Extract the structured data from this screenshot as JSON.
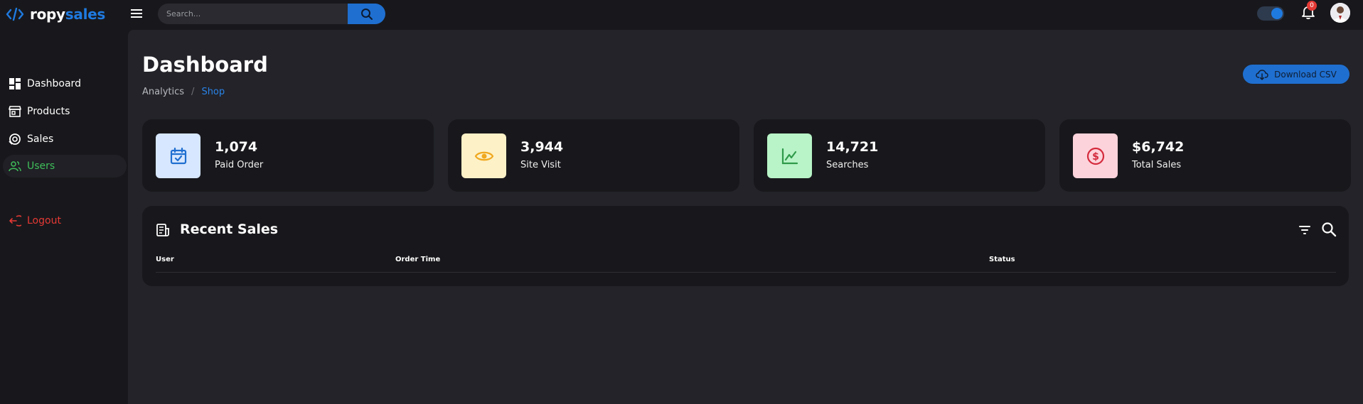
{
  "brand": {
    "part1": "ropy",
    "part2": "sales"
  },
  "search": {
    "placeholder": "Search..."
  },
  "notifications": {
    "count": "0"
  },
  "sidebar": {
    "items": [
      {
        "label": "Dashboard",
        "icon": "dashboard-icon"
      },
      {
        "label": "Products",
        "icon": "store-icon"
      },
      {
        "label": "Sales",
        "icon": "sales-icon"
      },
      {
        "label": "Users",
        "icon": "users-icon",
        "active": true
      },
      {
        "label": "Logout",
        "icon": "logout-icon"
      }
    ]
  },
  "main": {
    "title": "Dashboard",
    "breadcrumb": [
      "Analytics",
      "/",
      "Shop"
    ],
    "download_label": "Download CSV",
    "stats": [
      {
        "value": "1,074",
        "label": "Paid Order",
        "icon": "calendar-check-icon",
        "bg": "#d7e7ff",
        "fg": "#1f6fd0"
      },
      {
        "value": "3,944",
        "label": "Site Visit",
        "icon": "eye-icon",
        "bg": "#fdf1c7",
        "fg": "#f0a81e"
      },
      {
        "value": "14,721",
        "label": "Searches",
        "icon": "chart-line-icon",
        "bg": "#b8f4c7",
        "fg": "#2f9a4a"
      },
      {
        "value": "$6,742",
        "label": "Total Sales",
        "icon": "dollar-icon",
        "bg": "#fdd3db",
        "fg": "#d42a3c"
      }
    ],
    "recent_sales": {
      "title": "Recent Sales",
      "columns": [
        "User",
        "Order Time",
        "Status"
      ]
    }
  },
  "colors": {
    "accent": "#1f7ae0",
    "active": "#3fbf5a",
    "danger": "#e53935"
  }
}
